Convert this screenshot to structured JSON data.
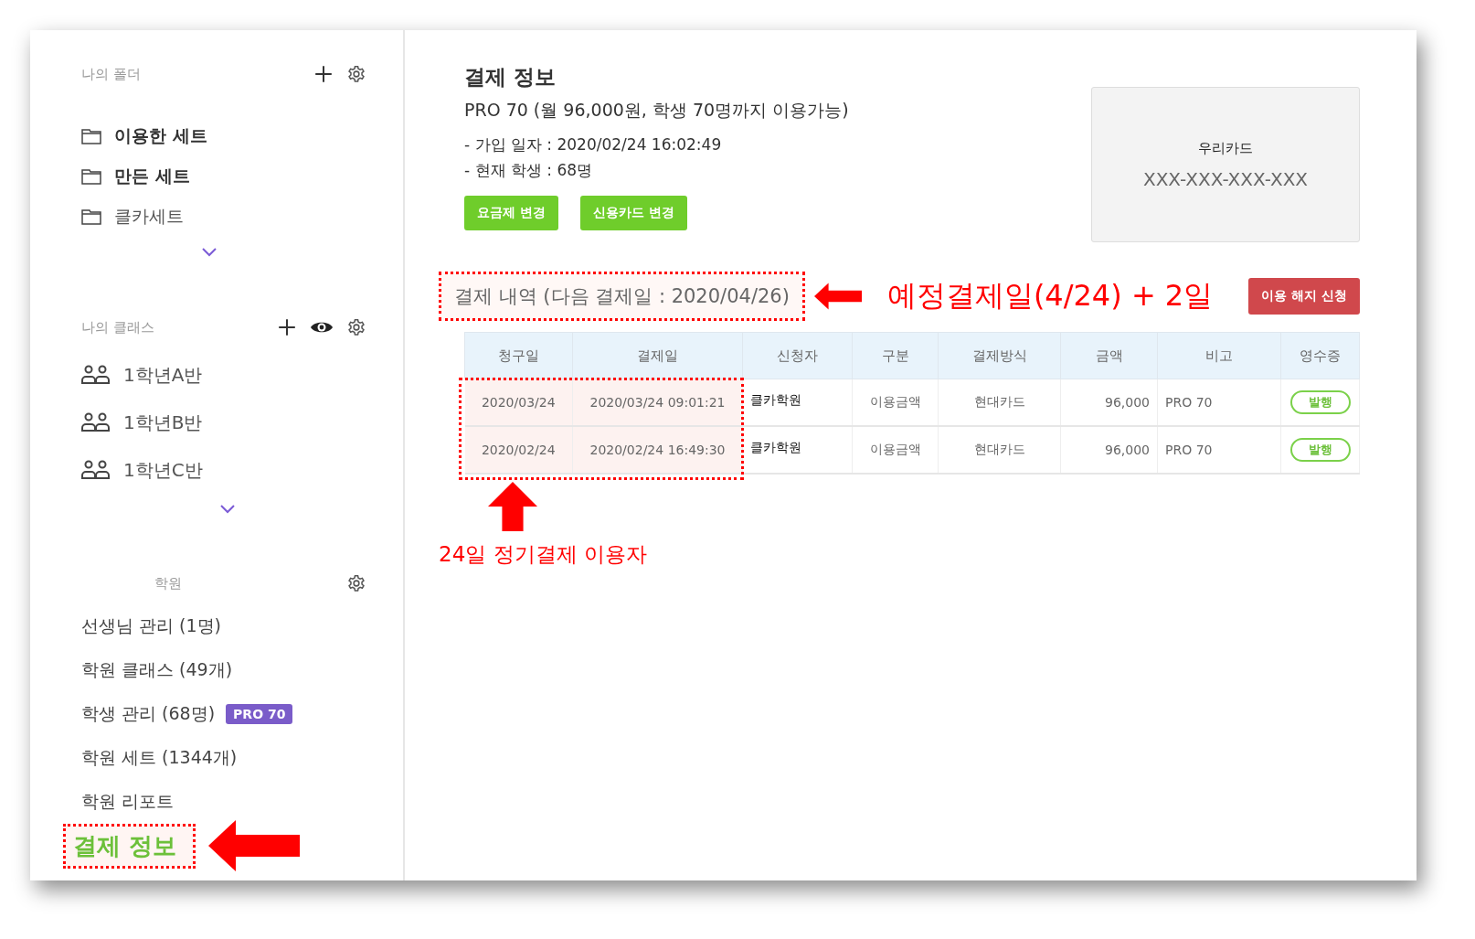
{
  "sidebar": {
    "folders": {
      "title": "나의 폴더",
      "items": [
        {
          "label": "이용한 세트",
          "emphasized": true
        },
        {
          "label": "만든 세트",
          "emphasized": true
        },
        {
          "label": "클카세트",
          "emphasized": false
        }
      ]
    },
    "classes": {
      "title": "나의 클래스",
      "items": [
        {
          "label": "1학년A반"
        },
        {
          "label": "1학년B반"
        },
        {
          "label": "1학년C반"
        }
      ]
    },
    "academy": {
      "title": "학원",
      "items": [
        {
          "label": "선생님 관리 (1명)",
          "selected": false
        },
        {
          "label": "학원 클래스 (49개)",
          "selected": false
        },
        {
          "label": "학생 관리 (68명)",
          "badge": "PRO 70",
          "selected": false
        },
        {
          "label": "학원 세트 (1344개)",
          "selected": false
        },
        {
          "label": "학원 리포트",
          "selected": false
        },
        {
          "label": "결제 정보",
          "selected": true
        }
      ]
    }
  },
  "main": {
    "title": "결제 정보",
    "plan": "PRO 70 (월 96,000원, 학생 70명까지 이용가능)",
    "details": [
      "- 가입 일자 : 2020/02/24 16:02:49",
      "- 현재 학생 : 68명"
    ],
    "buttons": [
      "요금제 변경",
      "신용카드 변경"
    ],
    "card": {
      "name": "우리카드",
      "number": "XXX-XXX-XXX-XXX"
    },
    "history": {
      "title": "결제 내역 (다음 결제일 : 2020/04/26)",
      "cancel_button": "이용 해지 신청",
      "table": {
        "columns": [
          "청구일",
          "결제일",
          "신청자",
          "구분",
          "결제방식",
          "금액",
          "비고",
          "영수증"
        ],
        "rows": [
          {
            "cells": [
              "2020/03/24",
              "2020/03/24 09:01:21",
              "클카학원",
              "이용금액",
              "현대카드",
              "96,000",
              "PRO 70"
            ],
            "receipt": "발행"
          },
          {
            "cells": [
              "2020/02/24",
              "2020/02/24 16:49:30",
              "클카학원",
              "이용금액",
              "현대카드",
              "96,000",
              "PRO 70"
            ],
            "receipt": "발행"
          }
        ]
      }
    }
  },
  "annotations": {
    "next_date_note": "예정결제일(4/24) + 2일",
    "billing_day_note": "24일 정기결제 이용자"
  }
}
